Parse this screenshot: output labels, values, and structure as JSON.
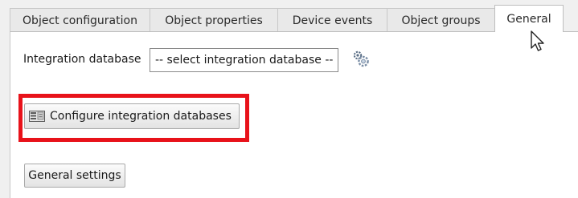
{
  "tabs": [
    {
      "label": "Object configuration",
      "active": false
    },
    {
      "label": "Object properties",
      "active": false
    },
    {
      "label": "Device events",
      "active": false
    },
    {
      "label": "Object groups",
      "active": false
    },
    {
      "label": "General",
      "active": true
    }
  ],
  "integration": {
    "label": "Integration database",
    "select_value": "-- select integration database --",
    "settings_icon": "gear-icon"
  },
  "buttons": {
    "configure_label": "Configure integration databases",
    "configure_icon": "database-config-icon",
    "general_label": "General settings"
  },
  "annotation": {
    "highlight_color": "#e8121a"
  }
}
